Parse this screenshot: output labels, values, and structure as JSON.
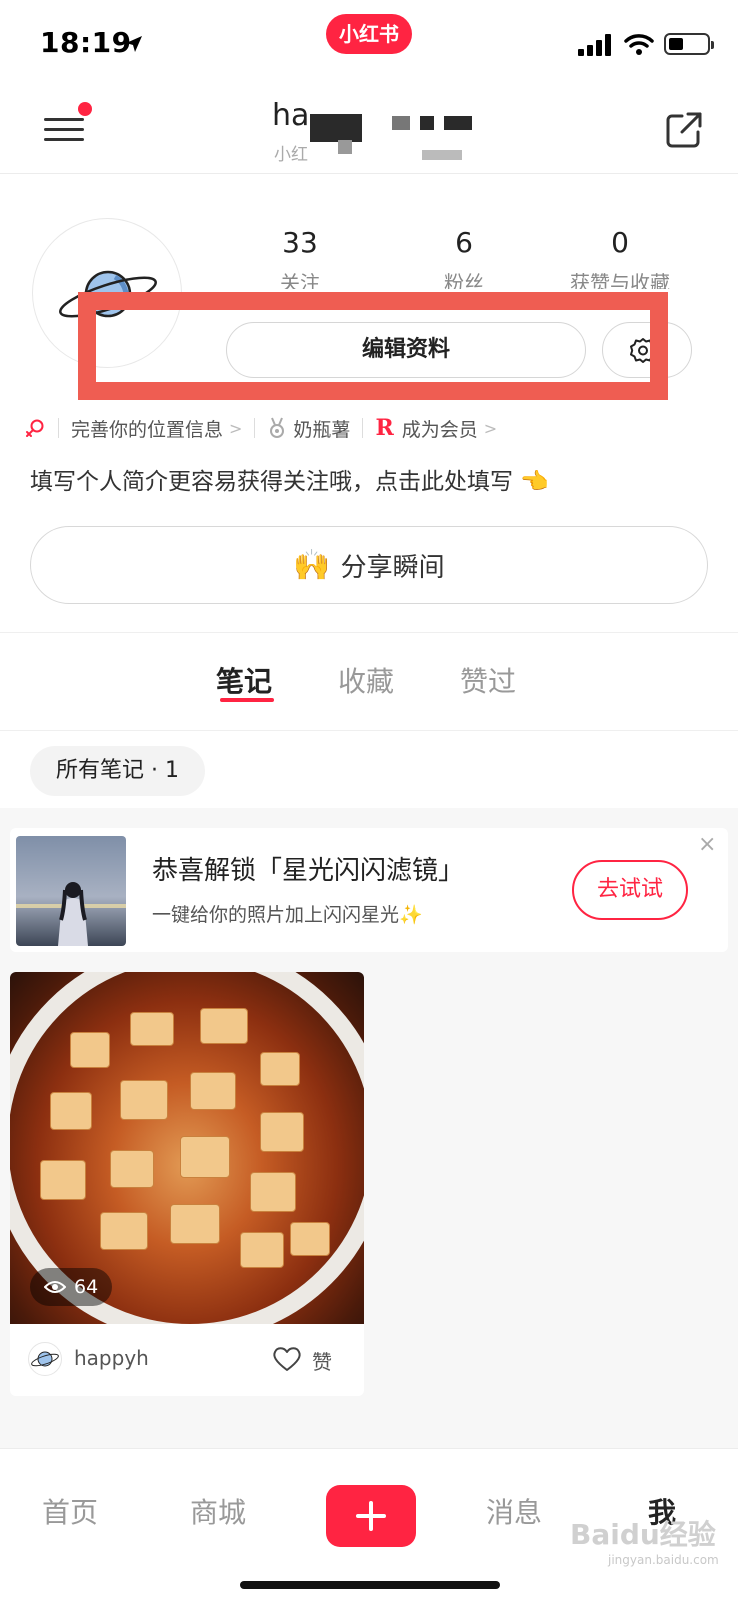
{
  "status_bar": {
    "time": "18:19",
    "app_badge": "小红书"
  },
  "header": {
    "name": "ha",
    "id_prefix": "小红"
  },
  "profile": {
    "stats": [
      {
        "value": "33",
        "label": "关注"
      },
      {
        "value": "6",
        "label": "粉丝"
      },
      {
        "value": "0",
        "label": "获赞与收藏"
      }
    ],
    "edit_label": "编辑资料",
    "location_text": "完善你的位置信息",
    "badge_text": "奶瓶薯",
    "member_text": "成为会员",
    "member_mark": "R",
    "bio": "填写个人简介更容易获得关注哦，点击此处填写 👈",
    "share_label": "分享瞬间",
    "share_emoji": "🙌"
  },
  "tabs": [
    {
      "label": "笔记",
      "active": true
    },
    {
      "label": "收藏",
      "active": false
    },
    {
      "label": "赞过",
      "active": false
    }
  ],
  "filter_chip": "所有笔记 · 1",
  "promo": {
    "title": "恭喜解锁「星光闪闪滤镜」",
    "subtitle": "一键给你的照片加上闪闪星光✨",
    "button": "去试试",
    "close": "×"
  },
  "note": {
    "views": "64",
    "author": "happyh",
    "like_label": "赞"
  },
  "bottom_nav": {
    "home": "首页",
    "mall": "商城",
    "messages": "消息",
    "me": "我",
    "watermark": "Baidu经验",
    "watermark_sub": "jingyan.baidu.com"
  },
  "colors": {
    "accent": "#ff2442",
    "highlight": "#ef5d52"
  }
}
